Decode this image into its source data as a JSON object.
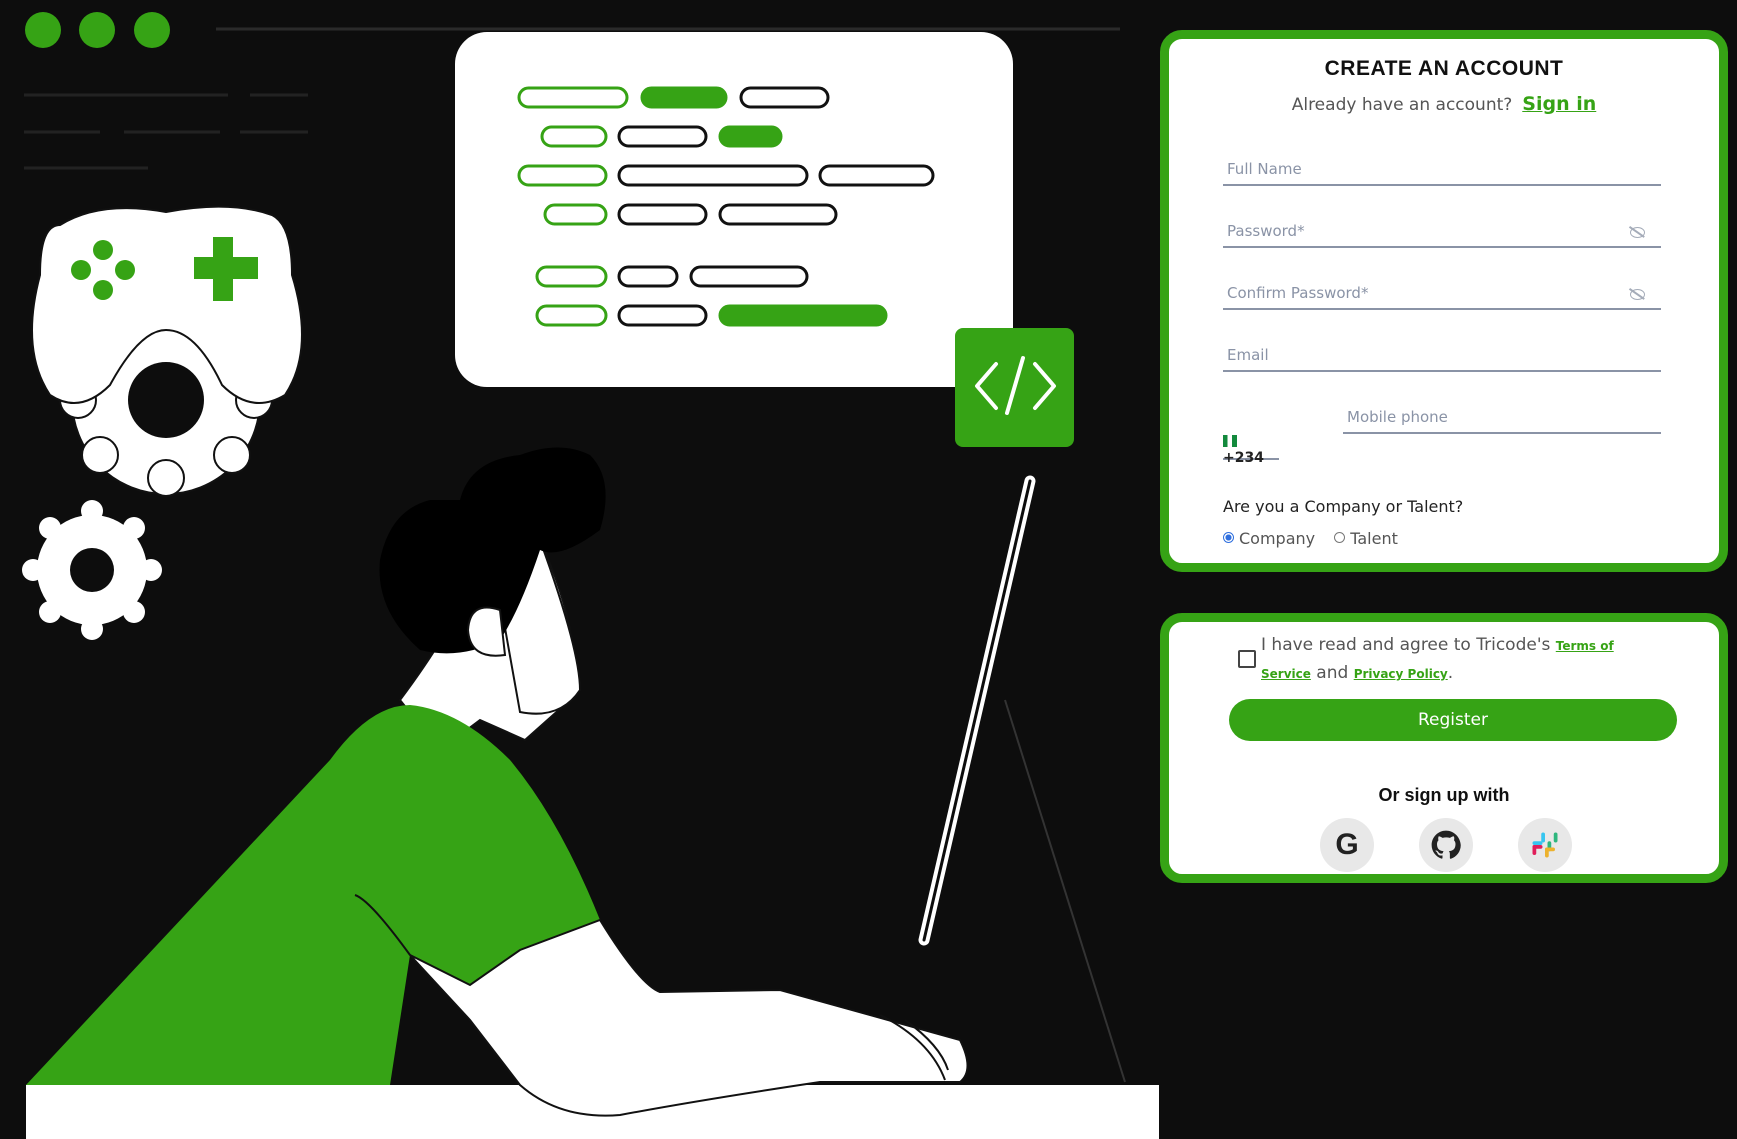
{
  "colors": {
    "accent": "#36a315",
    "background": "#0d0d0d",
    "radio_selected": "#2f6fde"
  },
  "form": {
    "title": "CREATE AN ACCOUNT",
    "subtitle": "Already have an account?",
    "signin_link": "Sign in",
    "fields": {
      "full_name_placeholder": "Full Name",
      "password_placeholder": "Password*",
      "confirm_password_placeholder": "Confirm Password*",
      "email_placeholder": "Email",
      "country_code": "+234",
      "mobile_placeholder": "Mobile phone"
    },
    "account_type_question": "Are you a Company or Talent?",
    "account_type_options": [
      {
        "label": "Company",
        "selected": true
      },
      {
        "label": "Talent",
        "selected": false
      }
    ]
  },
  "register": {
    "agree_text_1": "I have read and agree to Tricode's",
    "terms_link": "Terms of Service",
    "agree_and": "and",
    "privacy_link": "Privacy Policy",
    "agree_end": ".",
    "register_button": "Register",
    "or_signup": "Or sign up with",
    "social": [
      {
        "name": "google",
        "icon": "google-icon",
        "glyph": "G"
      },
      {
        "name": "github",
        "icon": "github-icon"
      },
      {
        "name": "slack",
        "icon": "slack-icon"
      }
    ]
  },
  "illustration": {
    "window_dots": 3,
    "code_icon_text": "</>"
  }
}
